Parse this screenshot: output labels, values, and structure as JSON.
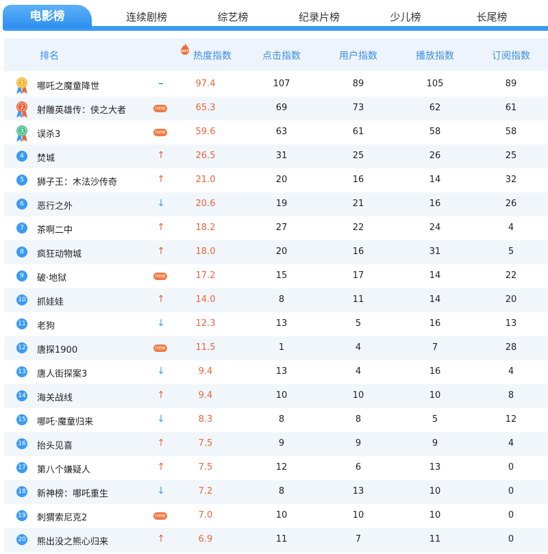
{
  "tabs": [
    {
      "label": "电影榜",
      "active": true
    },
    {
      "label": "连续剧榜"
    },
    {
      "label": "综艺榜"
    },
    {
      "label": "纪录片榜"
    },
    {
      "label": "少儿榜"
    },
    {
      "label": "长尾榜"
    }
  ],
  "header": {
    "rank": "排名",
    "hot_badge": "HOT",
    "score": "热度指数",
    "click": "点击指数",
    "user": "用户指数",
    "play": "播放指数",
    "subscribe": "订阅指数"
  },
  "new_label": "new",
  "colors": {
    "accent": "#3a9bf2",
    "score": "#e8643c",
    "flat": "#2bb073"
  },
  "rows": [
    {
      "rank": "1",
      "name": "哪吒之魔童降世",
      "trend": "flat",
      "score": "97.4",
      "click": "107",
      "user": "89",
      "play": "105",
      "sub": "89"
    },
    {
      "rank": "2",
      "name": "射雕英雄传：侠之大者",
      "trend": "new",
      "score": "65.3",
      "click": "69",
      "user": "73",
      "play": "62",
      "sub": "61"
    },
    {
      "rank": "3",
      "name": "误杀3",
      "trend": "new",
      "score": "59.6",
      "click": "63",
      "user": "61",
      "play": "58",
      "sub": "58"
    },
    {
      "rank": "4",
      "name": "焚城",
      "trend": "up",
      "score": "26.5",
      "click": "31",
      "user": "25",
      "play": "26",
      "sub": "25"
    },
    {
      "rank": "5",
      "name": "狮子王：木法沙传奇",
      "trend": "up",
      "score": "21.0",
      "click": "20",
      "user": "16",
      "play": "14",
      "sub": "32"
    },
    {
      "rank": "6",
      "name": "恶行之外",
      "trend": "down",
      "score": "20.6",
      "click": "19",
      "user": "21",
      "play": "16",
      "sub": "26"
    },
    {
      "rank": "7",
      "name": "茶啊二中",
      "trend": "up",
      "score": "18.2",
      "click": "27",
      "user": "22",
      "play": "24",
      "sub": "4"
    },
    {
      "rank": "8",
      "name": "疯狂动物城",
      "trend": "up",
      "score": "18.0",
      "click": "20",
      "user": "16",
      "play": "31",
      "sub": "5"
    },
    {
      "rank": "9",
      "name": "破·地狱",
      "trend": "new",
      "score": "17.2",
      "click": "15",
      "user": "17",
      "play": "14",
      "sub": "22"
    },
    {
      "rank": "10",
      "name": "抓娃娃",
      "trend": "up",
      "score": "14.0",
      "click": "8",
      "user": "11",
      "play": "14",
      "sub": "20"
    },
    {
      "rank": "11",
      "name": "老狗",
      "trend": "down",
      "score": "12.3",
      "click": "13",
      "user": "5",
      "play": "16",
      "sub": "13"
    },
    {
      "rank": "12",
      "name": "唐探1900",
      "trend": "new",
      "score": "11.5",
      "click": "1",
      "user": "4",
      "play": "7",
      "sub": "28"
    },
    {
      "rank": "13",
      "name": "唐人街探案3",
      "trend": "down",
      "score": "9.4",
      "click": "13",
      "user": "4",
      "play": "16",
      "sub": "4"
    },
    {
      "rank": "14",
      "name": "海关战线",
      "trend": "up",
      "score": "9.4",
      "click": "10",
      "user": "10",
      "play": "10",
      "sub": "8"
    },
    {
      "rank": "15",
      "name": "哪吒·魔童归来",
      "trend": "down",
      "score": "8.3",
      "click": "8",
      "user": "8",
      "play": "5",
      "sub": "12"
    },
    {
      "rank": "16",
      "name": "抬头见喜",
      "trend": "up",
      "score": "7.5",
      "click": "9",
      "user": "9",
      "play": "9",
      "sub": "4"
    },
    {
      "rank": "17",
      "name": "第八个嫌疑人",
      "trend": "up",
      "score": "7.5",
      "click": "12",
      "user": "6",
      "play": "13",
      "sub": "0"
    },
    {
      "rank": "18",
      "name": "新神榜：哪吒重生",
      "trend": "down",
      "score": "7.2",
      "click": "8",
      "user": "13",
      "play": "10",
      "sub": "0"
    },
    {
      "rank": "19",
      "name": "刺猬索尼克2",
      "trend": "new",
      "score": "7.0",
      "click": "10",
      "user": "10",
      "play": "10",
      "sub": "0"
    },
    {
      "rank": "20",
      "name": "熊出没之熊心归来",
      "trend": "up",
      "score": "6.9",
      "click": "11",
      "user": "7",
      "play": "11",
      "sub": "0"
    }
  ]
}
